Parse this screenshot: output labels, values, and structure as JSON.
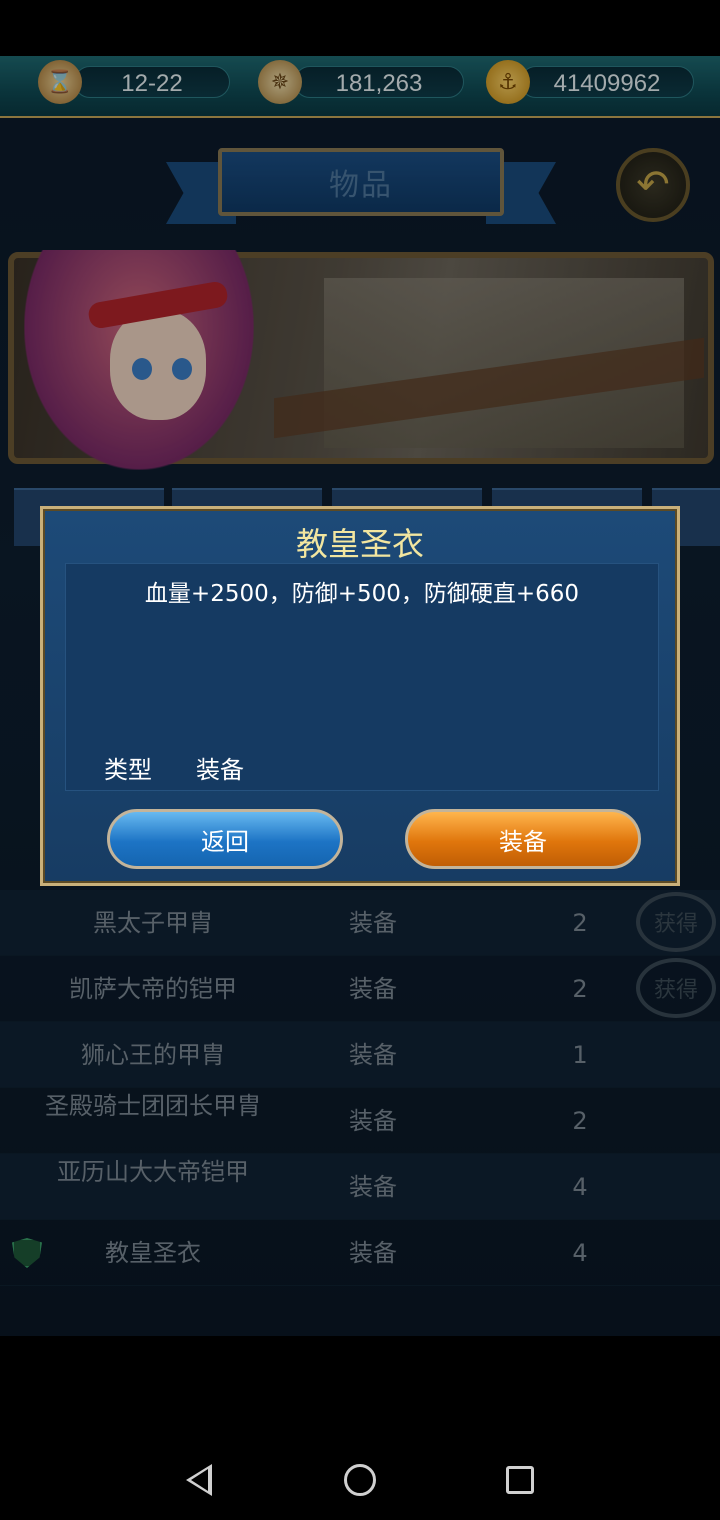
{
  "resources": [
    {
      "icon": "hourglass-icon",
      "value": "12-22"
    },
    {
      "icon": "compass-icon",
      "value": "181,263"
    },
    {
      "icon": "anchor-coin-icon",
      "value": "41409962"
    }
  ],
  "header": {
    "title": "物品"
  },
  "list_rows": [
    {
      "name": "黑太子甲胄",
      "type": "装备",
      "count": "2",
      "stamp": "获得"
    },
    {
      "name": "凯萨大帝的铠甲",
      "type": "装备",
      "count": "2",
      "stamp": "获得"
    },
    {
      "name": "狮心王的甲胄",
      "type": "装备",
      "count": "1"
    },
    {
      "name": "圣殿骑士团团长甲胄",
      "type": "装备",
      "count": "2"
    },
    {
      "name": "亚历山大大帝铠甲",
      "type": "装备",
      "count": "4"
    },
    {
      "name": "教皇圣衣",
      "type": "装备",
      "count": "4"
    }
  ],
  "dialog": {
    "title": "教皇圣衣",
    "description": "血量+2500，防御+500，防御硬直+660",
    "type_label": "类型",
    "type_value": "装备",
    "back_button": "返回",
    "equip_button": "装备"
  }
}
